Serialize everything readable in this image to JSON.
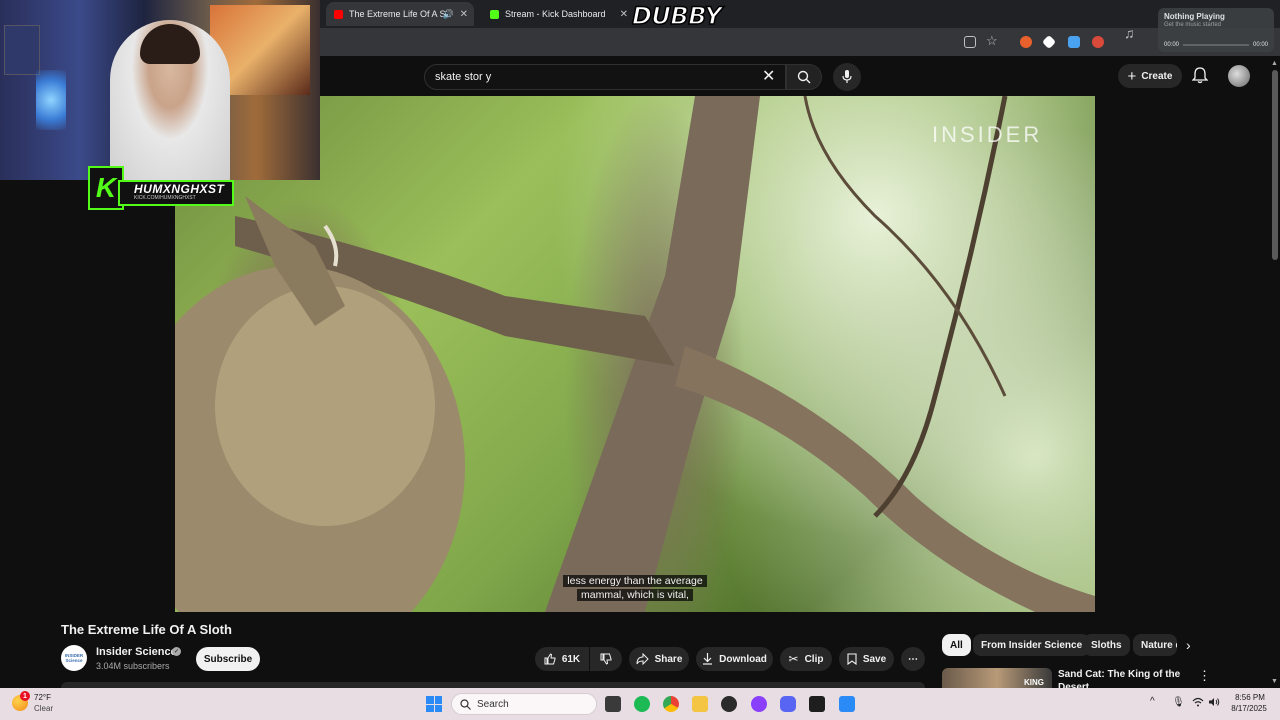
{
  "browser": {
    "tabs": [
      {
        "label": "The Extreme Life Of A Sloth",
        "active": true
      },
      {
        "label": "Stream - Kick Dashboard",
        "active": false
      }
    ]
  },
  "overlay": {
    "logo_text": "DUBBY",
    "streamer_name": "HUMXNGHXST",
    "streamer_url": "KICK.COM/HUMXNGHXST",
    "kick_letter": "K"
  },
  "music_widget": {
    "title": "Nothing Playing",
    "subtitle": "Get the music started",
    "time_start": "00:00",
    "time_end": "00:00"
  },
  "youtube": {
    "search_query": "skate stor y",
    "create_label": "Create",
    "video": {
      "watermark": "INSIDER",
      "caption_line1": "less energy than the average",
      "caption_line2": "mammal, which is vital,"
    },
    "title": "The Extreme Life Of A Sloth",
    "channel": {
      "name": "Insider Science",
      "subscribers": "3.04M subscribers",
      "avatar_text": "INSIDER Science"
    },
    "subscribe_label": "Subscribe",
    "actions": {
      "likes": "61K",
      "share": "Share",
      "download": "Download",
      "clip": "Clip",
      "save": "Save"
    },
    "chips": [
      "All",
      "From Insider Science",
      "Sloths",
      "Nature d"
    ],
    "recommendation": {
      "title": "Sand Cat: The King of the Desert",
      "thumb_text": "KING"
    }
  },
  "taskbar": {
    "weather_temp": "72°F",
    "weather_condition": "Clear",
    "weather_badge": "1",
    "search_placeholder": "Search",
    "time": "8:56 PM",
    "date": "8/17/2025"
  },
  "colors": {
    "kick_green": "#53fc18",
    "youtube_red": "#ff0000",
    "windows_blue": "#2a8af6"
  }
}
